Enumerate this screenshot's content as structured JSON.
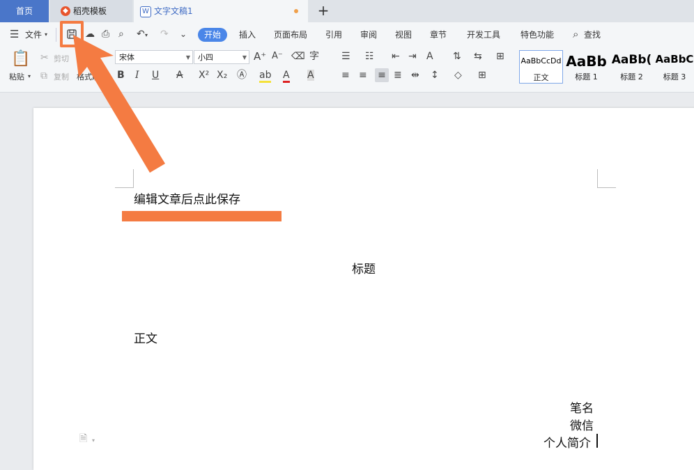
{
  "tabs": {
    "home": "首页",
    "template": "稻壳模板",
    "document": "文字文稿1",
    "new_tab": "+"
  },
  "menu": {
    "file": "文件",
    "tabs": [
      "开始",
      "插入",
      "页面布局",
      "引用",
      "审阅",
      "视图",
      "章节",
      "开发工具",
      "特色功能"
    ],
    "active_tab": "开始",
    "search": "查找"
  },
  "toolbar": {
    "paste": "粘贴",
    "cut": "剪切",
    "copy": "复制",
    "format_painter": "格式刷",
    "font_name": "宋体",
    "font_size": "小四"
  },
  "styles": [
    {
      "preview": "AaBbCcDd",
      "name": "正文"
    },
    {
      "preview": "AaBb",
      "name": "标题 1"
    },
    {
      "preview": "AaBb(",
      "name": "标题 2"
    },
    {
      "preview": "AaBbC",
      "name": "标题 3"
    }
  ],
  "document": {
    "annotation_note": "编辑文章后点此保存",
    "title": "标题",
    "body": "正文",
    "pen_name": "笔名",
    "wechat": "微信",
    "bio": "个人简介"
  },
  "colors": {
    "accent": "#4a86e8",
    "annotation": "#f47b42",
    "home_tab": "#4a76c9",
    "tab_dot": "#f0a04b"
  }
}
